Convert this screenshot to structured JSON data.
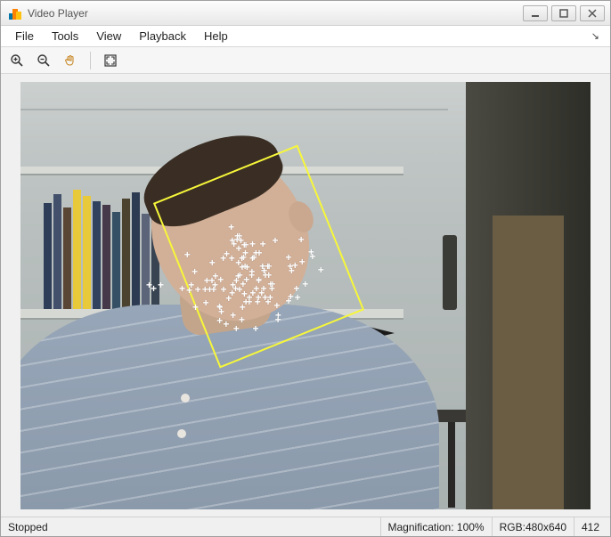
{
  "window": {
    "title": "Video Player"
  },
  "menu": {
    "items": [
      "File",
      "Tools",
      "View",
      "Playback",
      "Help"
    ]
  },
  "toolbar": {
    "zoom_in": "zoom-in",
    "zoom_out": "zoom-out",
    "pan": "pan-hand",
    "fit": "fit-to-window"
  },
  "status": {
    "state": "Stopped",
    "magnification_label": "Magnification:",
    "magnification_value": "100%",
    "format": "RGB:480x640",
    "extra": "412"
  },
  "overlay": {
    "bbox_color": "#f7f73a",
    "point_marker": "+"
  }
}
